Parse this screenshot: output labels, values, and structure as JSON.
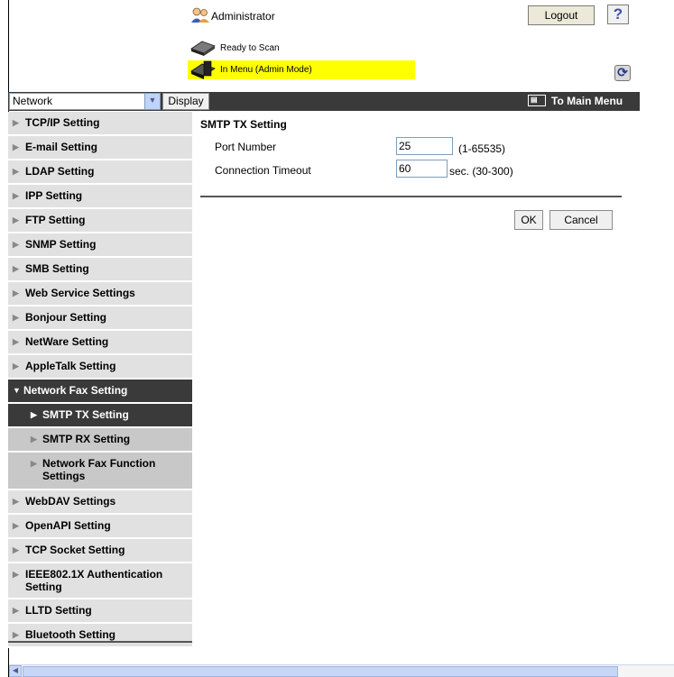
{
  "header": {
    "role": "Administrator",
    "logout_label": "Logout",
    "help_label": "?",
    "status_ready": "Ready to Scan",
    "status_menu": "In Menu (Admin Mode)"
  },
  "toolbar": {
    "category_select": "Network",
    "display_label": "Display",
    "main_menu_label": "To Main Menu"
  },
  "sidebar": {
    "items": [
      {
        "label": "TCP/IP Setting"
      },
      {
        "label": "E-mail Setting"
      },
      {
        "label": "LDAP Setting"
      },
      {
        "label": "IPP Setting"
      },
      {
        "label": "FTP Setting"
      },
      {
        "label": "SNMP Setting"
      },
      {
        "label": "SMB Setting"
      },
      {
        "label": "Web Service Settings"
      },
      {
        "label": "Bonjour Setting"
      },
      {
        "label": "NetWare Setting"
      },
      {
        "label": "AppleTalk Setting"
      },
      {
        "label": "Network Fax Setting"
      },
      {
        "label": "WebDAV Settings"
      },
      {
        "label": "OpenAPI Setting"
      },
      {
        "label": "TCP Socket Setting"
      },
      {
        "label": "IEEE802.1X Authentication Setting"
      },
      {
        "label": "LLTD Setting"
      },
      {
        "label": "Bluetooth Setting"
      }
    ],
    "subitems": [
      {
        "label": "SMTP TX Setting"
      },
      {
        "label": "SMTP RX Setting"
      },
      {
        "label": "Network Fax Function Settings"
      }
    ]
  },
  "main": {
    "title": "SMTP TX Setting",
    "port_label": "Port Number",
    "port_value": "25",
    "port_hint": "(1-65535)",
    "timeout_label": "Connection Timeout",
    "timeout_value": "60",
    "timeout_hint": "sec. (30-300)",
    "ok_label": "OK",
    "cancel_label": "Cancel"
  },
  "colors": {
    "active_bg": "#3a3a3a",
    "nav_bg": "#e1e1e1",
    "sub_bg": "#c8c8c8",
    "status_highlight": "#ffff00"
  }
}
